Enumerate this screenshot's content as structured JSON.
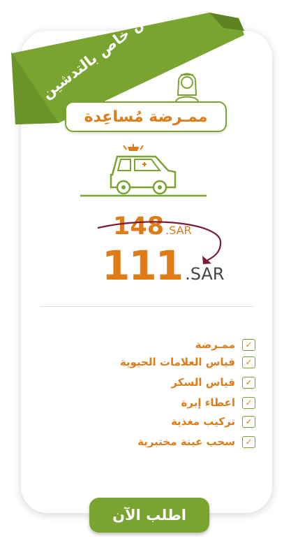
{
  "ribbon": {
    "text": "عرض خاص بالتدشين"
  },
  "service": {
    "title": "ممـرضة مُساعِدة"
  },
  "prices": {
    "old_amount": "148",
    "old_currency": ".SAR",
    "new_amount": "111",
    "new_currency": ".SAR"
  },
  "features": [
    {
      "label": "ممـرضة"
    },
    {
      "label": "قياس العلامات الحيوية"
    },
    {
      "label": "قياس السكر"
    },
    {
      "label": "اعطاء إبرة"
    },
    {
      "label": "تركيب مغذية"
    },
    {
      "label": "سحب عينة مختبرية"
    }
  ],
  "cta": {
    "label": "اطلب الآن"
  },
  "icons": {
    "ribbon": "ribbon-banner",
    "nurse": "nurse-icon",
    "car": "ambulance-car-icon",
    "check": "check-icon"
  },
  "colors": {
    "accent": "#e07c17",
    "green": "#78a42f",
    "strike": "#7a1a3a"
  }
}
